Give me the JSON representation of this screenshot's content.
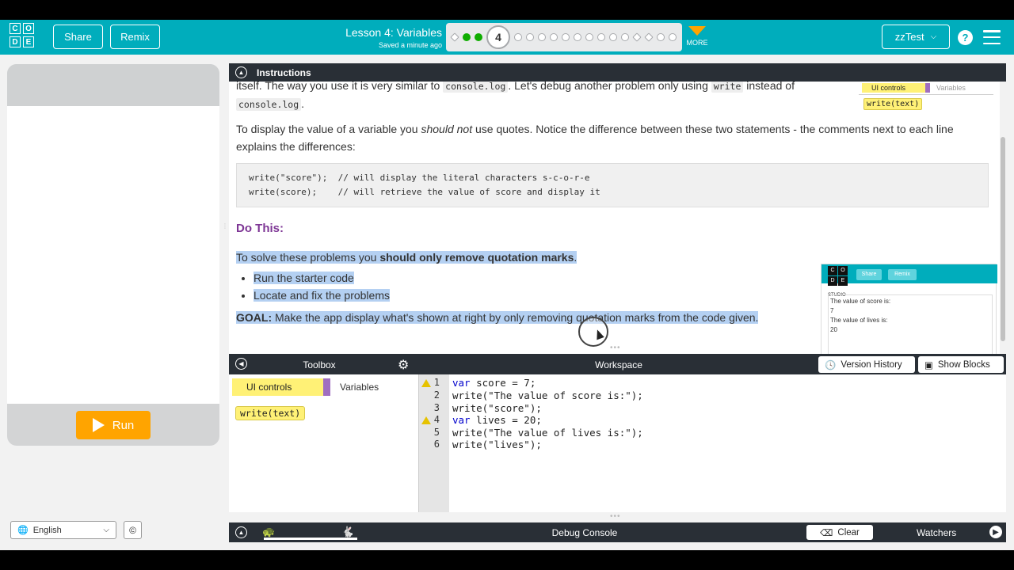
{
  "header": {
    "logo_letters": [
      "C",
      "O",
      "D",
      "E"
    ],
    "share_label": "Share",
    "remix_label": "Remix",
    "lesson_title": "Lesson 4: Variables",
    "saved_text": "Saved a minute ago",
    "current_level": "4",
    "more_label": "MORE",
    "user_label": "zzTest",
    "help_label": "?"
  },
  "app_panel": {
    "run_label": "Run",
    "language": "English",
    "copyright": "©"
  },
  "instructions": {
    "header_label": "Instructions",
    "line_top_a": "itself. The way you use it is very similar to ",
    "line_top_code1": "console.log",
    "line_top_b": ". Let's debug another problem only using ",
    "line_top_code2": "write",
    "line_top_c": " instead of",
    "line2_code": "console.log",
    "line2_end": ".",
    "para2_a": "To display the value of a variable you ",
    "para2_em": "should not",
    "para2_b": " use quotes. Notice the difference between these two statements - the comments next to each line explains the differences:",
    "code_example": "write(\"score\");  // will display the literal characters s-c-o-r-e\nwrite(score);    // will retrieve the value of score and display it",
    "do_this": "Do This:",
    "solve_a": "To solve these problems you ",
    "solve_b": "should only remove quotation marks",
    "solve_c": ".",
    "bullets": [
      "Run the starter code",
      "Locate and fix the problems"
    ],
    "goal_label": "GOAL:",
    "goal_text": " Make the app display what's shown at right by only removing quotation marks from the code given.",
    "thumb_top": {
      "cat_ui": "UI controls",
      "cat_var": "Variables",
      "block": "write(text)"
    },
    "thumb_app": {
      "logo_letters": [
        "C",
        "O",
        "D",
        "E"
      ],
      "share": "Share",
      "remix": "Remix",
      "studio": "STUDIO",
      "lines": [
        "The value of score is:",
        "7",
        "The value of lives is:",
        "20"
      ]
    }
  },
  "toolbox": {
    "title": "Toolbox",
    "cat_ui": "UI controls",
    "cat_var": "Variables",
    "block": "write(text)"
  },
  "workspace": {
    "title": "Workspace",
    "version_history": "Version History",
    "show_blocks": "Show Blocks",
    "code_lines": [
      {
        "n": "1",
        "warn": true,
        "kw": "var",
        "rest": " score = 7;"
      },
      {
        "n": "2",
        "warn": false,
        "kw": "",
        "rest": "write(\"The value of score is:\");"
      },
      {
        "n": "3",
        "warn": false,
        "kw": "",
        "rest": "write(\"score\");"
      },
      {
        "n": "4",
        "warn": true,
        "kw": "var",
        "rest": " lives = 20;"
      },
      {
        "n": "5",
        "warn": false,
        "kw": "",
        "rest": "write(\"The value of lives is:\");"
      },
      {
        "n": "6",
        "warn": false,
        "kw": "",
        "rest": "write(\"lives\");"
      }
    ]
  },
  "debug": {
    "title": "Debug Console",
    "clear": "Clear",
    "watchers": "Watchers"
  },
  "colors": {
    "header_bg": "#00adbc",
    "dark_bar": "#292f36",
    "run_orange": "#ffa400",
    "highlight": "#b4d0f2",
    "do_this_purple": "#7e3695"
  }
}
